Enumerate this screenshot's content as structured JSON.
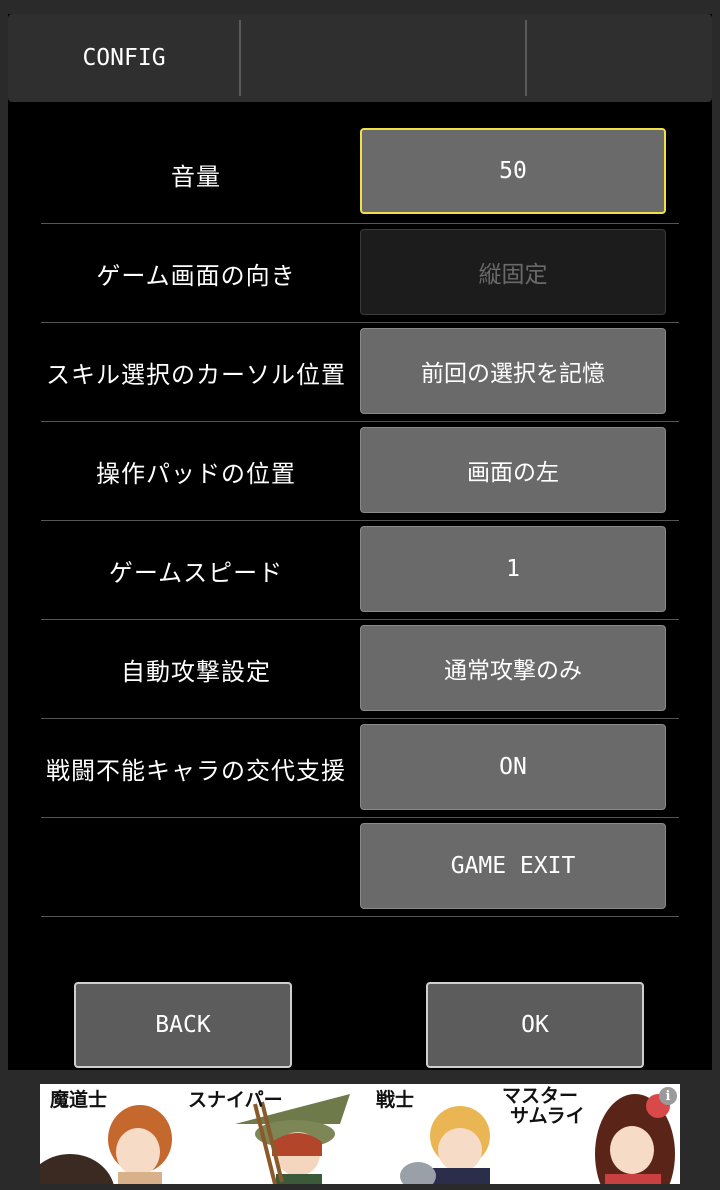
{
  "tabs": [
    {
      "label": "CONFIG"
    },
    {
      "label": ""
    },
    {
      "label": ""
    }
  ],
  "settings": [
    {
      "label": "音量",
      "value": "50",
      "state": "selected"
    },
    {
      "label": "ゲーム画面の向き",
      "value": "縦固定",
      "state": "disabled"
    },
    {
      "label": "スキル選択のカーソル位置",
      "value": "前回の選択を記憶",
      "state": "normal"
    },
    {
      "label": "操作パッドの位置",
      "value": "画面の左",
      "state": "normal"
    },
    {
      "label": "ゲームスピード",
      "value": "1",
      "state": "normal"
    },
    {
      "label": "自動攻撃設定",
      "value": "通常攻撃のみ",
      "state": "normal"
    },
    {
      "label": "戦闘不能キャラの交代支援",
      "value": "ON",
      "state": "normal"
    },
    {
      "label": "",
      "value": "GAME EXIT",
      "state": "normal"
    }
  ],
  "buttons": {
    "back": "BACK",
    "ok": "OK"
  },
  "ad": {
    "labels": [
      "魔道士",
      "スナイパー",
      "戦士",
      "マスター",
      "サムライ"
    ],
    "info_icon": "i"
  },
  "colors": {
    "selected_border": "#f0e04a",
    "button_bg": "#6a6a6a",
    "background": "#000000"
  }
}
